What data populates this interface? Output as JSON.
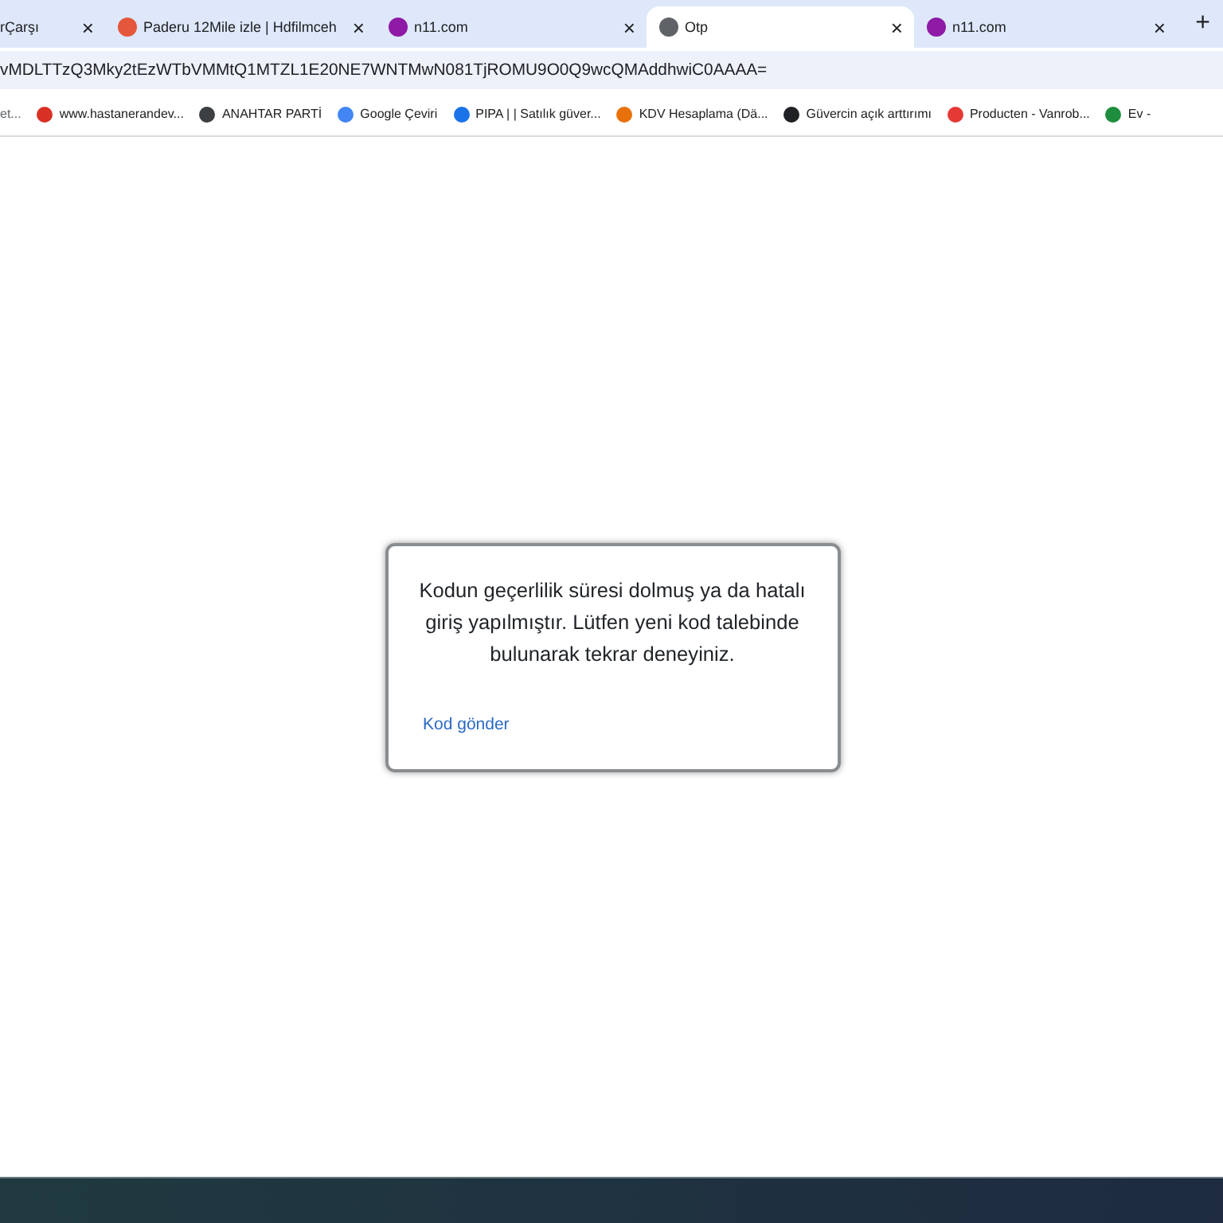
{
  "tabs": [
    {
      "title": "rÇarşı",
      "close": "×",
      "selected": false
    },
    {
      "title": "Paderu 12Mile izle | Hdfilmceh",
      "close": "×",
      "selected": false
    },
    {
      "title": "n11.com",
      "close": "×",
      "selected": false
    },
    {
      "title": "Otp",
      "close": "×",
      "selected": true
    },
    {
      "title": "n11.com",
      "close": "×",
      "selected": false
    }
  ],
  "new_tab": "+",
  "address_bar": {
    "value": "vMDLTTzQ3Mky2tEzWTbVMMtQ1MTZL1E20NE7WNTMwN081TjROMU9O0Q9wcQMAddhwiC0AAAA="
  },
  "bookmarks": [
    {
      "label": "et...",
      "color": "#5f6368"
    },
    {
      "label": "www.hastanerandev...",
      "color": "#d93025"
    },
    {
      "label": "ANAHTAR PARTİ",
      "color": "#3c4043"
    },
    {
      "label": "Google Çeviri",
      "color": "#4285f4"
    },
    {
      "label": "PIPA | | Satılık güver...",
      "color": "#1a73e8"
    },
    {
      "label": "KDV Hesaplama (Dä...",
      "color": "#e8710a"
    },
    {
      "label": "Güvercin açık arttırımı",
      "color": "#202124"
    },
    {
      "label": "Producten - Vanrob...",
      "color": "#e53935"
    },
    {
      "label": "Ev -",
      "color": "#1e8e3e"
    }
  ],
  "dialog": {
    "message": "Kodun geçerlilik süresi dolmuş ya da hatalı giriş yapılmıştır. Lütfen yeni kod talebinde bulunarak tekrar deneyiniz.",
    "link": "Kod gönder"
  }
}
